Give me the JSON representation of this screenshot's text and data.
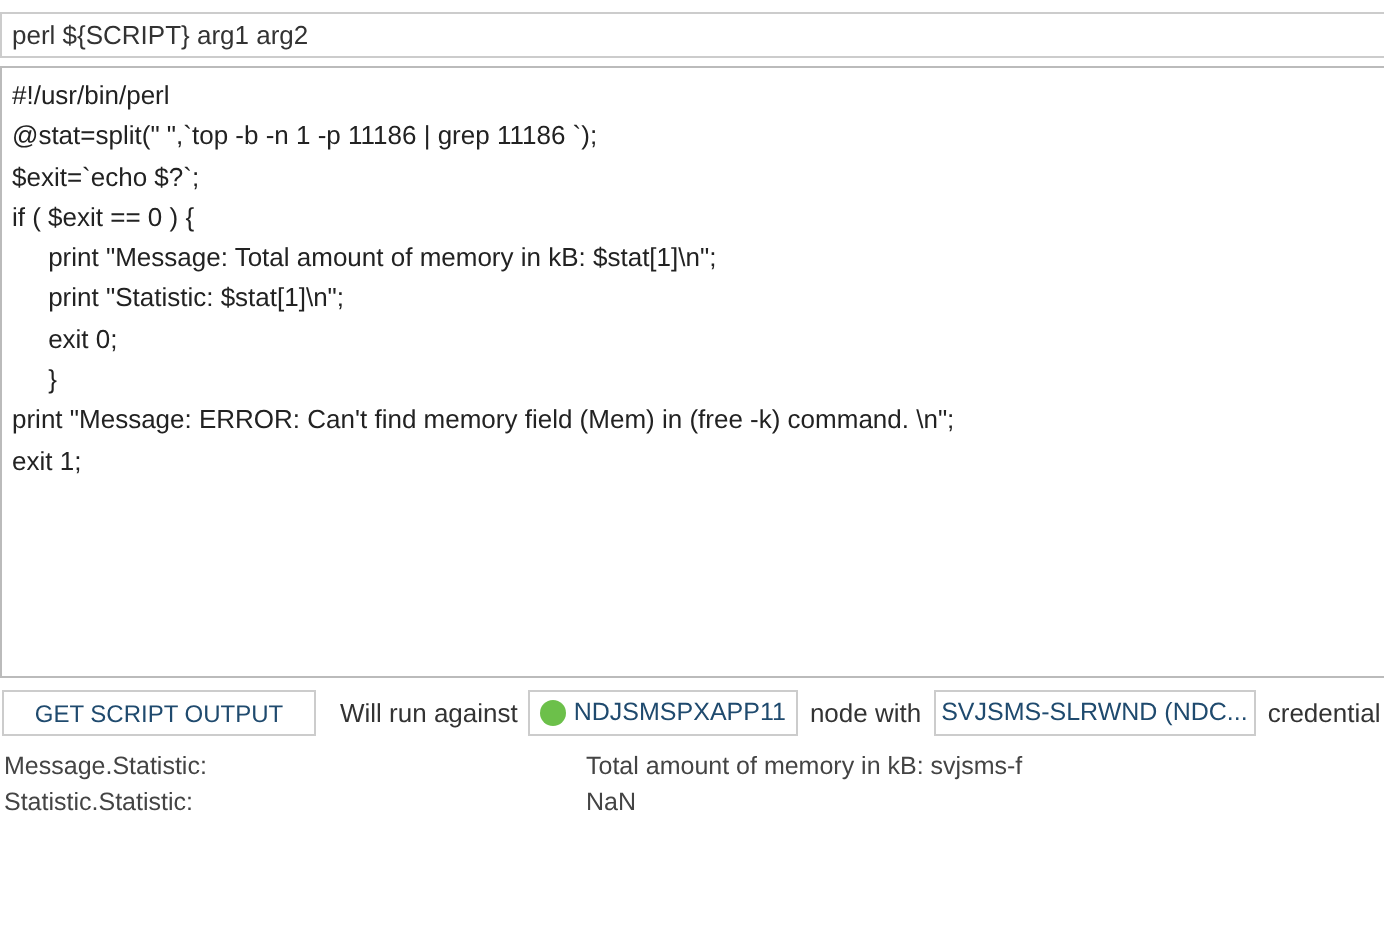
{
  "command": {
    "value": "perl ${SCRIPT} arg1 arg2"
  },
  "script": {
    "value": "#!/usr/bin/perl\n@stat=split(\" \",`top -b -n 1 -p 11186 | grep 11186 `);\n$exit=`echo $?`;\nif ( $exit == 0 ) {\n\tprint \"Message: Total amount of memory in kB: $stat[1]\\n\";\n\tprint \"Statistic: $stat[1]\\n\";\n\texit 0;\n\t}\nprint \"Message: ERROR: Can't find memory field (Mem) in (free -k) command. \\n\";\nexit 1;"
  },
  "run_bar": {
    "button": "GET SCRIPT OUTPUT",
    "prefix": "Will run against",
    "node": {
      "label": "NDJSMSPXAPP11",
      "color": "#6cc04a"
    },
    "middle": "node with",
    "credential": "SVJSMS-SLRWND (NDC...",
    "suffix": "credential"
  },
  "results": [
    {
      "key": "Message.Statistic:",
      "value": "Total amount of memory in kB: svjsms-f"
    },
    {
      "key": "Statistic.Statistic:",
      "value": "NaN"
    }
  ]
}
